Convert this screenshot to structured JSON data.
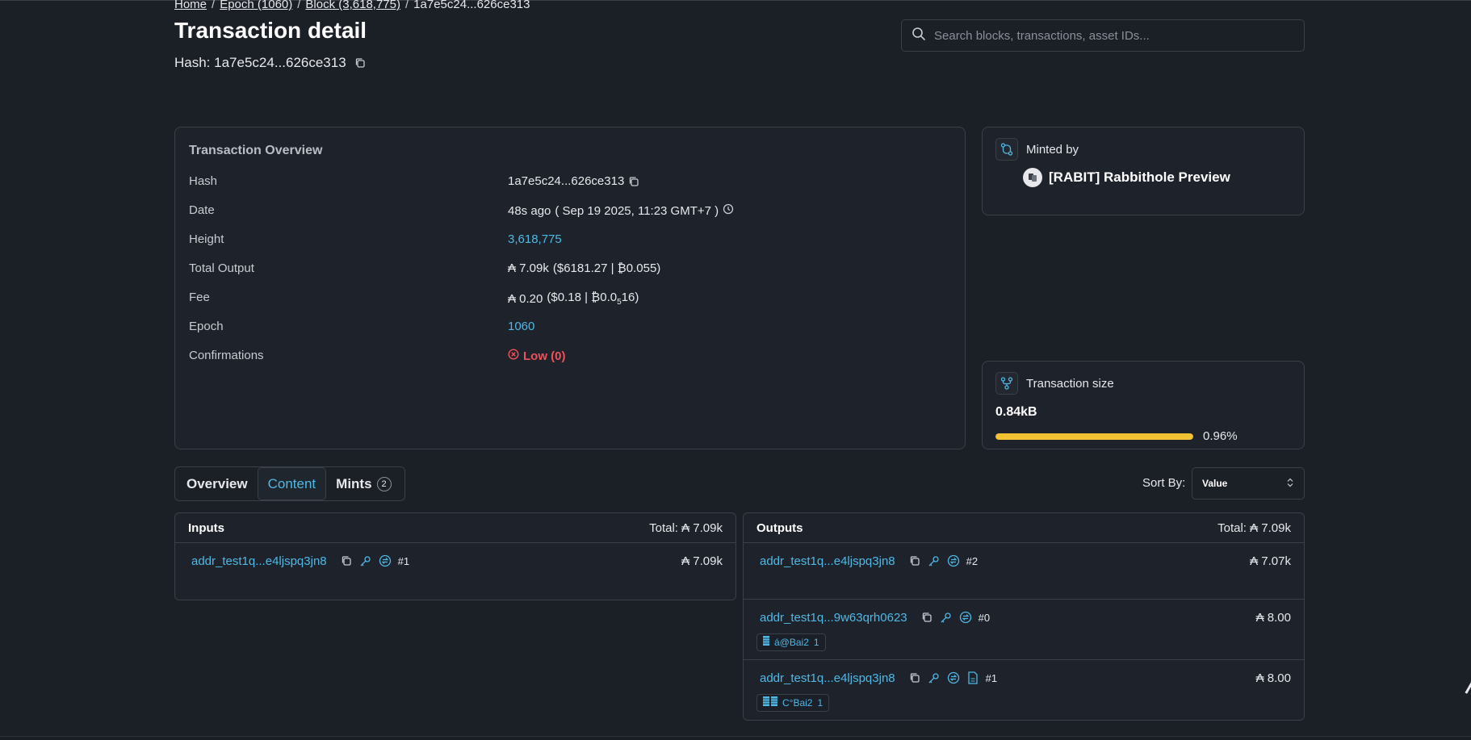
{
  "breadcrumb": {
    "home": "Home",
    "epoch": "Epoch (1060)",
    "block": "Block (3,618,775)",
    "current": "1a7e5c24...626ce313",
    "separator": "/"
  },
  "page": {
    "title": "Transaction detail",
    "hash_line": "Hash: 1a7e5c24...626ce313"
  },
  "search": {
    "placeholder": "Search blocks, transactions, asset IDs..."
  },
  "overview": {
    "title": "Transaction Overview",
    "rows": [
      {
        "label": "Hash",
        "value": "1a7e5c24...626ce313"
      },
      {
        "label": "Date",
        "value": "48s ago",
        "detail": "( Sep 19 2025, 11:23 GMT+7 )"
      },
      {
        "label": "Height",
        "value": "3,618,775"
      },
      {
        "label": "Total Output",
        "value": "₳ 7.09k",
        "detail": "($6181.27 | ₿0.055)"
      },
      {
        "label": "Fee",
        "value": "₳ 0.20",
        "detail_a": "($0.18 | ₿0.0",
        "detail_sub": "5",
        "detail_b": "16)"
      },
      {
        "label": "Epoch",
        "value": "1060"
      },
      {
        "label": "Confirmations",
        "value": "Low (0)"
      }
    ]
  },
  "minted": {
    "label": "Minted by",
    "name": "[RABIT] Rabbithole Preview"
  },
  "tx_size": {
    "label": "Transaction size",
    "value": "0.84kB",
    "percent_label": "0.96%",
    "percent": 0.96
  },
  "tabs": [
    {
      "label": "Overview"
    },
    {
      "label": "Content"
    },
    {
      "label": "Mints",
      "count": "2"
    }
  ],
  "sort": {
    "label": "Sort By:",
    "value": "Value"
  },
  "inputs": {
    "title": "Inputs",
    "total": "Total: ₳ 7.09k",
    "rows": [
      {
        "address": "addr_test1q...e4ljspq3jn8",
        "index": "#1",
        "amount": "₳ 7.09k"
      }
    ]
  },
  "outputs": {
    "title": "Outputs",
    "total": "Total: ₳ 7.09k",
    "rows": [
      {
        "address": "addr_test1q...e4ljspq3jn8",
        "index": "#2",
        "amount": "₳ 7.07k"
      },
      {
        "address": "addr_test1q...9w63qrh0623",
        "index": "#0",
        "amount": "₳ 8.00",
        "asset": "á@Bai2",
        "asset_qty": "1"
      },
      {
        "address": "addr_test1q...e4ljspq3jn8",
        "index": "#1",
        "amount": "₳ 8.00",
        "asset": "C°Bai2",
        "asset_qty": "1"
      }
    ]
  },
  "colors": {
    "background": "#1b1f26",
    "accent": "#4fb8e6",
    "danger": "#f0505a",
    "progress": "#f2c233"
  }
}
